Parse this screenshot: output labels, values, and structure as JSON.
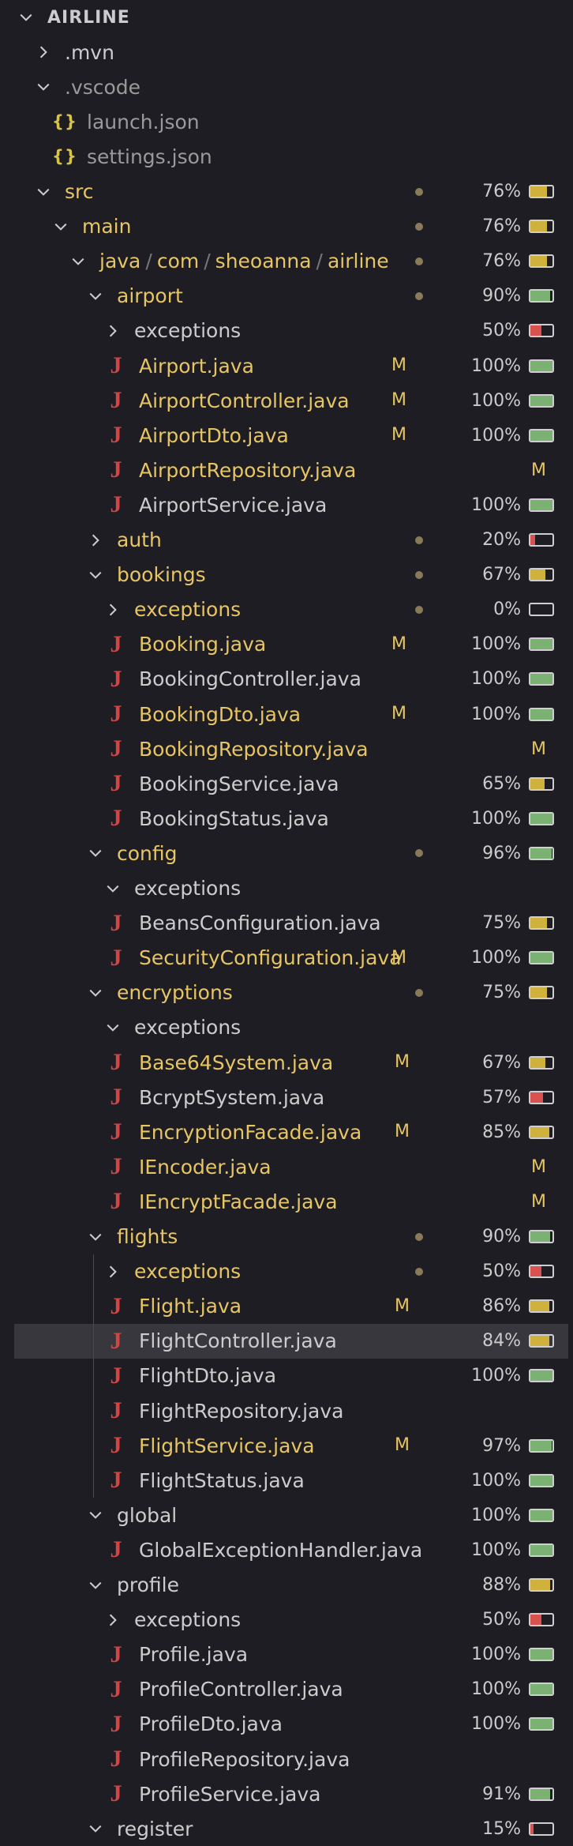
{
  "colors": {
    "high": "#7bb274",
    "mid": "#d0b13c",
    "low": "#d9524f",
    "modified_text": "#e6c564",
    "java_icon": "#d14545",
    "json_icon": "#d7c24a",
    "selected_row_bg": "#37373d"
  },
  "explorer": {
    "root_label": "AIRLINE",
    "items": [
      {
        "label": "AIRLINE",
        "depth": 0,
        "kind": "root",
        "expanded": true
      },
      {
        "label": ".mvn",
        "depth": 1,
        "kind": "folder",
        "expanded": false,
        "style": "plain"
      },
      {
        "label": ".vscode",
        "depth": 1,
        "kind": "folder",
        "expanded": true,
        "style": "dim"
      },
      {
        "label": "launch.json",
        "depth": 2,
        "kind": "json",
        "style": "dim"
      },
      {
        "label": "settings.json",
        "depth": 2,
        "kind": "json",
        "style": "dim"
      },
      {
        "label": "src",
        "depth": 1,
        "kind": "folder",
        "expanded": true,
        "style": "mod",
        "dot": true,
        "pct": "76%",
        "cov": 0.76
      },
      {
        "label": "main",
        "depth": 2,
        "kind": "folder",
        "expanded": true,
        "style": "mod",
        "dot": true,
        "pct": "76%",
        "cov": 0.76
      },
      {
        "label": "java / com / sheoanna / airline",
        "segments": [
          "java",
          "com",
          "sheoanna",
          "airline"
        ],
        "depth": 3,
        "kind": "path",
        "expanded": true,
        "style": "mod",
        "dot": true,
        "pct": "76%",
        "cov": 0.76
      },
      {
        "label": "airport",
        "depth": 4,
        "kind": "folder",
        "expanded": true,
        "style": "mod",
        "dot": true,
        "pct": "90%",
        "cov": 0.9
      },
      {
        "label": "exceptions",
        "depth": 5,
        "kind": "folder",
        "expanded": false,
        "style": "plain",
        "pct": "50%",
        "cov": 0.5
      },
      {
        "label": "Airport.java",
        "depth": 5,
        "kind": "java",
        "style": "mod",
        "badge": "M",
        "pct": "100%",
        "cov": 1.0
      },
      {
        "label": "AirportController.java",
        "depth": 5,
        "kind": "java",
        "style": "mod",
        "badge": "M",
        "pct": "100%",
        "cov": 1.0
      },
      {
        "label": "AirportDto.java",
        "depth": 5,
        "kind": "java",
        "style": "mod",
        "badge": "M",
        "pct": "100%",
        "cov": 1.0
      },
      {
        "label": "AirportRepository.java",
        "depth": 5,
        "kind": "java",
        "style": "mod",
        "badge_right": "M"
      },
      {
        "label": "AirportService.java",
        "depth": 5,
        "kind": "java",
        "style": "plain",
        "pct": "100%",
        "cov": 1.0
      },
      {
        "label": "auth",
        "depth": 4,
        "kind": "folder",
        "expanded": false,
        "style": "mod",
        "dot": true,
        "pct": "20%",
        "cov": 0.2
      },
      {
        "label": "bookings",
        "depth": 4,
        "kind": "folder",
        "expanded": true,
        "style": "mod",
        "dot": true,
        "pct": "67%",
        "cov": 0.67
      },
      {
        "label": "exceptions",
        "depth": 5,
        "kind": "folder",
        "expanded": false,
        "style": "mod",
        "dot": true,
        "pct": "0%",
        "cov": 0.0
      },
      {
        "label": "Booking.java",
        "depth": 5,
        "kind": "java",
        "style": "mod",
        "badge": "M",
        "pct": "100%",
        "cov": 1.0
      },
      {
        "label": "BookingController.java",
        "depth": 5,
        "kind": "java",
        "style": "plain",
        "pct": "100%",
        "cov": 1.0
      },
      {
        "label": "BookingDto.java",
        "depth": 5,
        "kind": "java",
        "style": "mod",
        "badge": "M",
        "pct": "100%",
        "cov": 1.0
      },
      {
        "label": "BookingRepository.java",
        "depth": 5,
        "kind": "java",
        "style": "mod",
        "badge_right": "M"
      },
      {
        "label": "BookingService.java",
        "depth": 5,
        "kind": "java",
        "style": "plain",
        "pct": "65%",
        "cov": 0.65
      },
      {
        "label": "BookingStatus.java",
        "depth": 5,
        "kind": "java",
        "style": "plain",
        "pct": "100%",
        "cov": 1.0
      },
      {
        "label": "config",
        "depth": 4,
        "kind": "folder",
        "expanded": true,
        "style": "mod",
        "dot": true,
        "pct": "96%",
        "cov": 0.96
      },
      {
        "label": "exceptions",
        "depth": 5,
        "kind": "folder",
        "expanded": true,
        "style": "plain"
      },
      {
        "label": "BeansConfiguration.java",
        "depth": 5,
        "kind": "java",
        "style": "plain",
        "pct": "75%",
        "cov": 0.75
      },
      {
        "label": "SecurityConfiguration.java",
        "depth": 5,
        "kind": "java",
        "style": "mod",
        "badge": "M",
        "pct": "100%",
        "cov": 1.0
      },
      {
        "label": "encryptions",
        "depth": 4,
        "kind": "folder",
        "expanded": true,
        "style": "mod",
        "dot": true,
        "pct": "75%",
        "cov": 0.75
      },
      {
        "label": "exceptions",
        "depth": 5,
        "kind": "folder",
        "expanded": true,
        "style": "plain"
      },
      {
        "label": "Base64System.java",
        "depth": 5,
        "kind": "java",
        "style": "mod",
        "badge": "M",
        "pct": "67%",
        "cov": 0.67
      },
      {
        "label": "BcryptSystem.java",
        "depth": 5,
        "kind": "java",
        "style": "plain",
        "pct": "57%",
        "cov": 0.57
      },
      {
        "label": "EncryptionFacade.java",
        "depth": 5,
        "kind": "java",
        "style": "mod",
        "badge": "M",
        "pct": "85%",
        "cov": 0.85
      },
      {
        "label": "IEncoder.java",
        "depth": 5,
        "kind": "java",
        "style": "mod",
        "badge_right": "M"
      },
      {
        "label": "IEncryptFacade.java",
        "depth": 5,
        "kind": "java",
        "style": "mod",
        "badge_right": "M"
      },
      {
        "label": "flights",
        "depth": 4,
        "kind": "folder",
        "expanded": true,
        "style": "mod",
        "dot": true,
        "pct": "90%",
        "cov": 0.9
      },
      {
        "label": "exceptions",
        "depth": 5,
        "kind": "folder",
        "expanded": false,
        "style": "mod",
        "dot": true,
        "pct": "50%",
        "cov": 0.5
      },
      {
        "label": "Flight.java",
        "depth": 5,
        "kind": "java",
        "style": "mod",
        "badge": "M",
        "pct": "86%",
        "cov": 0.86
      },
      {
        "label": "FlightController.java",
        "depth": 5,
        "kind": "java",
        "style": "plain",
        "pct": "84%",
        "cov": 0.84,
        "selected": true
      },
      {
        "label": "FlightDto.java",
        "depth": 5,
        "kind": "java",
        "style": "plain",
        "pct": "100%",
        "cov": 1.0
      },
      {
        "label": "FlightRepository.java",
        "depth": 5,
        "kind": "java",
        "style": "plain"
      },
      {
        "label": "FlightService.java",
        "depth": 5,
        "kind": "java",
        "style": "mod",
        "badge": "M",
        "pct": "97%",
        "cov": 0.97
      },
      {
        "label": "FlightStatus.java",
        "depth": 5,
        "kind": "java",
        "style": "plain",
        "pct": "100%",
        "cov": 1.0
      },
      {
        "label": "global",
        "depth": 4,
        "kind": "folder",
        "expanded": true,
        "style": "plain",
        "pct": "100%",
        "cov": 1.0
      },
      {
        "label": "GlobalExceptionHandler.java",
        "depth": 5,
        "kind": "java",
        "style": "plain",
        "pct": "100%",
        "cov": 1.0
      },
      {
        "label": "profile",
        "depth": 4,
        "kind": "folder",
        "expanded": true,
        "style": "plain",
        "pct": "88%",
        "cov": 0.88
      },
      {
        "label": "exceptions",
        "depth": 5,
        "kind": "folder",
        "expanded": false,
        "style": "plain",
        "pct": "50%",
        "cov": 0.5
      },
      {
        "label": "Profile.java",
        "depth": 5,
        "kind": "java",
        "style": "plain",
        "pct": "100%",
        "cov": 1.0
      },
      {
        "label": "ProfileController.java",
        "depth": 5,
        "kind": "java",
        "style": "plain",
        "pct": "100%",
        "cov": 1.0
      },
      {
        "label": "ProfileDto.java",
        "depth": 5,
        "kind": "java",
        "style": "plain",
        "pct": "100%",
        "cov": 1.0
      },
      {
        "label": "ProfileRepository.java",
        "depth": 5,
        "kind": "java",
        "style": "plain"
      },
      {
        "label": "ProfileService.java",
        "depth": 5,
        "kind": "java",
        "style": "plain",
        "pct": "91%",
        "cov": 0.91
      },
      {
        "label": "register",
        "depth": 4,
        "kind": "folder",
        "expanded": true,
        "style": "plain",
        "pct": "15%",
        "cov": 0.15
      }
    ]
  }
}
